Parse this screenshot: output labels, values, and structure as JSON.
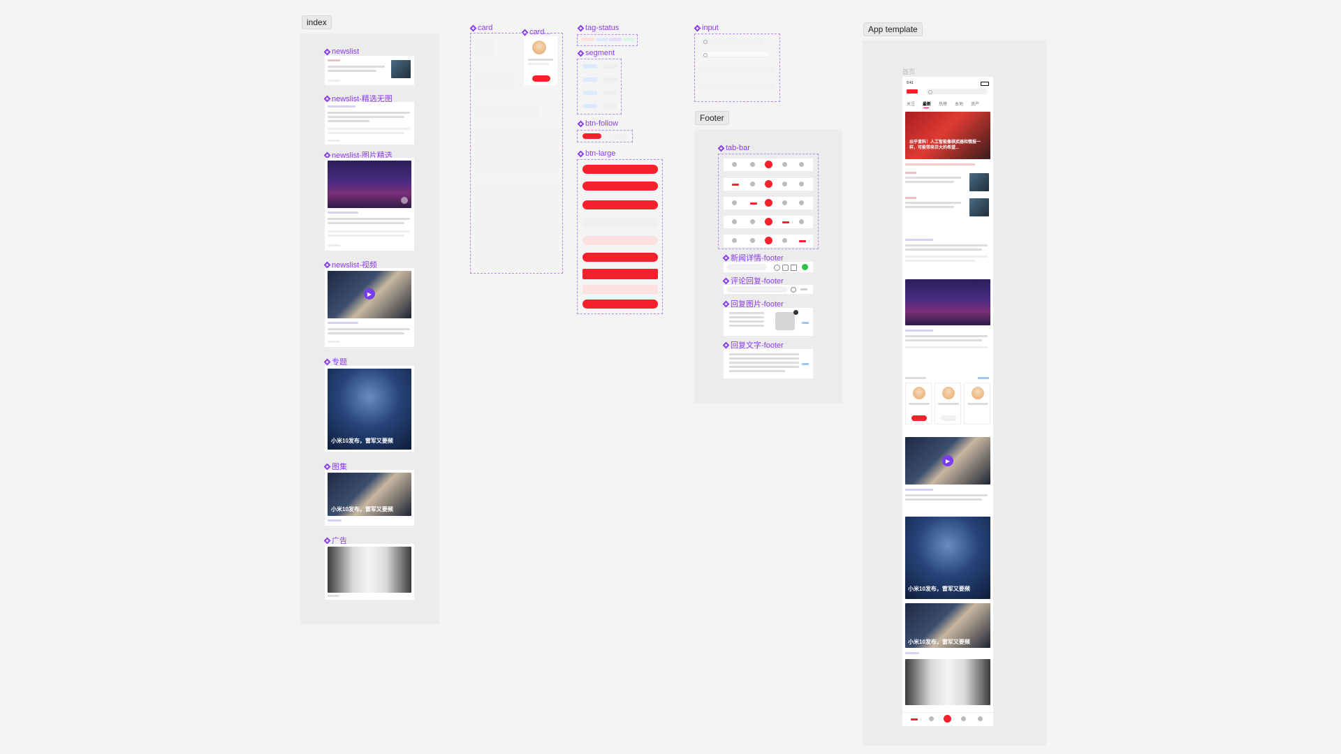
{
  "frames": {
    "index": "index",
    "footer": "Footer",
    "app_template": "App template"
  },
  "components": {
    "newslist": "newslist",
    "newslist_nopic": "newslist-精选无图",
    "newslist_pic": "newslist-图片精选",
    "newslist_video": "newslist-视频",
    "topic": "专题",
    "gallery": "图集",
    "ad": "广告",
    "card": "card",
    "card_more": "card...",
    "tag_status": "tag-status",
    "segment": "segment",
    "btn_follow": "btn-follow",
    "btn_large": "btn-large",
    "input": "input",
    "tab_bar": "tab-bar",
    "news_detail_footer": "新闻详情-footer",
    "comment_reply_footer": "评论回复-footer",
    "reply_image_footer": "回复图片-footer",
    "reply_text_footer": "回复文字-footer"
  },
  "overlay_texts": {
    "xiaomi": "小米10发布，雷军又要频",
    "app_video_headline": "出乎意料！人工智能像棋武器和情报一样，可能带来巨大的希望..."
  },
  "app": {
    "page_label": "首页",
    "time": "9:41",
    "tabs": [
      "关注",
      "最新",
      "热榜",
      "本地",
      "资产"
    ]
  },
  "colors": {
    "accent_purple": "#8a3ee8",
    "brand_red": "#f5222d",
    "panel_grey": "#ececec"
  }
}
